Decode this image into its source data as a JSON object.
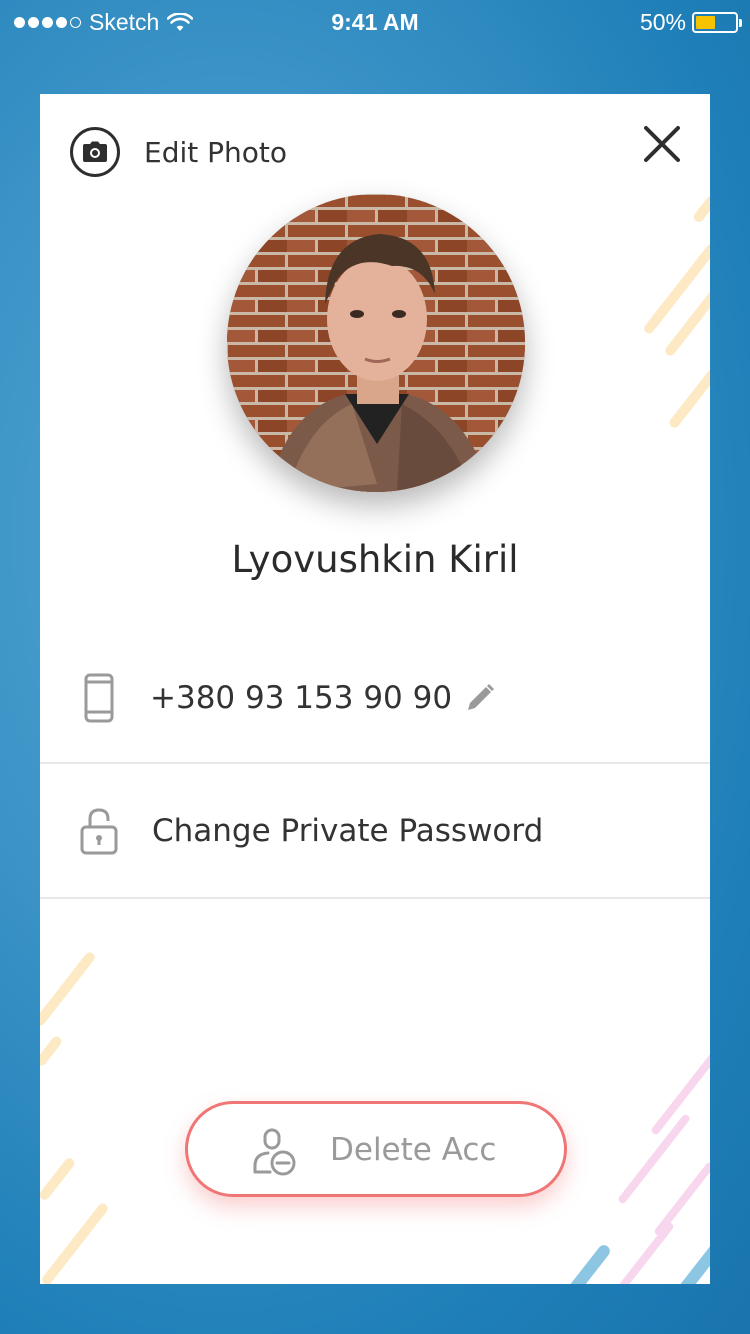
{
  "status_bar": {
    "carrier": "Sketch",
    "time": "9:41 AM",
    "battery": "50%",
    "battery_level": 0.5
  },
  "header": {
    "edit_photo_label": "Edit Photo",
    "camera_icon": "camera-icon",
    "close_icon": "close-icon"
  },
  "profile": {
    "name": "Lyovushkin Kiril"
  },
  "rows": {
    "phone": "+380 93 153 90 90",
    "password": "Change Private Password"
  },
  "actions": {
    "delete_label": "Delete Acc"
  },
  "colors": {
    "accent_red": "#f07676",
    "background_blue": "#3b93c6",
    "deco_yellow": "#fde9c4",
    "deco_pink": "#f8d6ee",
    "deco_blue": "#8cc6e3"
  }
}
